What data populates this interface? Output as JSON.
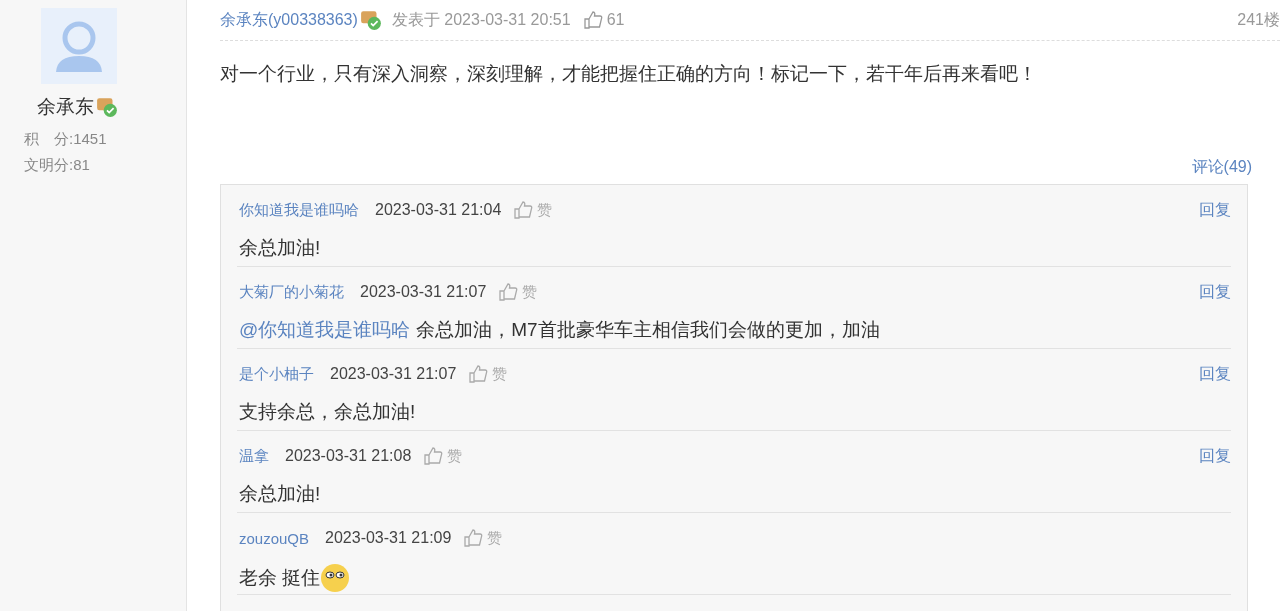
{
  "author": {
    "name": "余承东",
    "verified": true,
    "stats": [
      {
        "label": "积　分:",
        "value": "1451"
      },
      {
        "label": "文明分:",
        "value": "81"
      }
    ]
  },
  "post": {
    "author": "余承东(y00338363)",
    "verified": true,
    "posted": "发表于 2023-03-31 20:51",
    "likes": "61",
    "floor": "241楼",
    "body": "对一个行业，只有深入洞察，深刻理解，才能把握住正确的方向！标记一下，若干年后再来看吧！",
    "comments_link": "评论(49)"
  },
  "comments": [
    {
      "user": "你知道我是谁吗哈",
      "time": "2023-03-31 21:04",
      "like": "赞",
      "reply": "回复",
      "text": "余总加油!"
    },
    {
      "user": "大菊厂的小菊花",
      "time": "2023-03-31 21:07",
      "like": "赞",
      "reply": "回复",
      "mention": "@你知道我是谁吗哈",
      "text": "余总加油，M7首批豪华车主相信我们会做的更加，加油"
    },
    {
      "user": "是个小柚子",
      "time": "2023-03-31 21:07",
      "like": "赞",
      "reply": "回复",
      "text": "支持余总，余总加油!"
    },
    {
      "user": "温拿",
      "time": "2023-03-31 21:08",
      "like": "赞",
      "reply": "回复",
      "text": "余总加油!"
    },
    {
      "user": "zouzouQB",
      "time": "2023-03-31 21:09",
      "like": "赞",
      "text": "老余  挺住",
      "emoji": true
    }
  ]
}
